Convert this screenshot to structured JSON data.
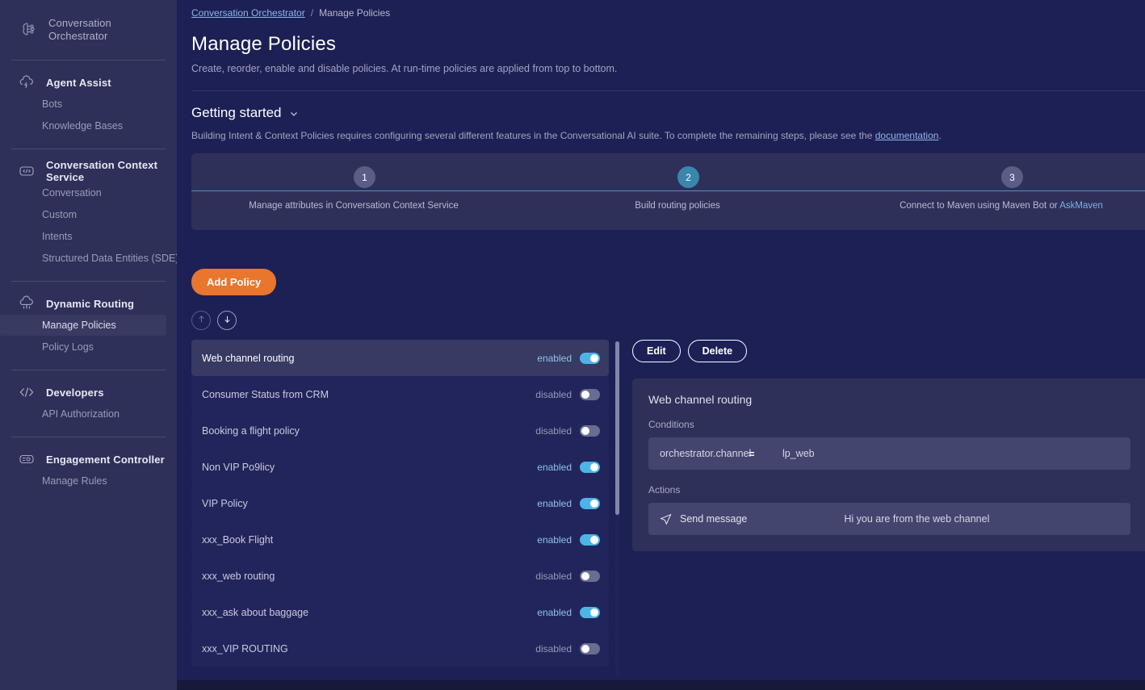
{
  "brand": {
    "line1": "Conversation",
    "line2": "Orchestrator",
    "icon": "brain-network-icon"
  },
  "sidebar": {
    "groups": [
      {
        "head": "Agent Assist",
        "icon": "cloud-lightning-icon",
        "items": [
          {
            "label": "Bots",
            "active": false
          },
          {
            "label": "Knowledge Bases",
            "active": false
          }
        ]
      },
      {
        "head": "Conversation Context Service",
        "icon": "code-bubble-icon",
        "items": [
          {
            "label": "Conversation",
            "active": false
          },
          {
            "label": "Custom",
            "active": false
          },
          {
            "label": "Intents",
            "active": false
          },
          {
            "label": "Structured Data Entities (SDE)",
            "active": false
          }
        ]
      },
      {
        "head": "Dynamic Routing",
        "icon": "cloud-routing-icon",
        "items": [
          {
            "label": "Manage Policies",
            "active": true
          },
          {
            "label": "Policy Logs",
            "active": false
          }
        ]
      },
      {
        "head": "Developers",
        "icon": "code-brackets-icon",
        "items": [
          {
            "label": "API Authorization",
            "active": false
          }
        ]
      },
      {
        "head": "Engagement Controller",
        "icon": "chat-gear-icon",
        "items": [
          {
            "label": "Manage Rules",
            "active": false
          }
        ]
      }
    ]
  },
  "breadcrumb": {
    "root": "Conversation Orchestrator",
    "separator": "/",
    "current": "Manage Policies"
  },
  "header": {
    "title": "Manage Policies",
    "subtitle": "Create, reorder, enable and disable policies. At run-time policies are applied from top to bottom."
  },
  "getting_started": {
    "title": "Getting started",
    "chevron_icon": "chevron-down-icon",
    "desc_before": "Building Intent & Context Policies requires configuring several different features in the Conversational AI suite. To complete the remaining steps, please see the ",
    "desc_link": "documentation",
    "desc_after": ".",
    "steps": [
      {
        "number": "1",
        "label": "Manage attributes in Conversation Context Service",
        "state": "muted",
        "link": ""
      },
      {
        "number": "2",
        "label": "Build routing policies",
        "state": "active",
        "link": ""
      },
      {
        "number": "3",
        "label": "Connect to Maven using Maven Bot or ",
        "state": "muted",
        "link": "AskMaven"
      }
    ]
  },
  "toolbar": {
    "add_policy_label": "Add Policy",
    "move_up_icon": "arrow-up-icon",
    "move_down_icon": "arrow-down-icon",
    "move_up_enabled": false,
    "move_down_enabled": true
  },
  "policy_list": {
    "state_on_label": "enabled",
    "state_off_label": "disabled",
    "rows": [
      {
        "name": "Web channel routing",
        "enabled": true,
        "selected": true
      },
      {
        "name": "Consumer Status from CRM",
        "enabled": false,
        "selected": false
      },
      {
        "name": "Booking a flight policy",
        "enabled": false,
        "selected": false
      },
      {
        "name": "Non VIP Po9licy",
        "enabled": true,
        "selected": false
      },
      {
        "name": "VIP Policy",
        "enabled": true,
        "selected": false
      },
      {
        "name": "xxx_Book Flight",
        "enabled": true,
        "selected": false
      },
      {
        "name": "xxx_web routing",
        "enabled": false,
        "selected": false
      },
      {
        "name": "xxx_ask about baggage",
        "enabled": true,
        "selected": false
      },
      {
        "name": "xxx_VIP ROUTING",
        "enabled": false,
        "selected": false
      }
    ]
  },
  "detail": {
    "edit_label": "Edit",
    "delete_label": "Delete",
    "title": "Web channel routing",
    "conditions_label": "Conditions",
    "conditions": [
      {
        "key": "orchestrator.channel",
        "operator": "=",
        "value": "lp_web"
      }
    ],
    "actions_label": "Actions",
    "actions": [
      {
        "icon": "send-message-icon",
        "name": "Send message",
        "value": "Hi you are from the web channel"
      }
    ]
  },
  "colors": {
    "sidebar_bg": "#2e3059",
    "main_bg": "#1d2055",
    "accent_orange": "#e8762c",
    "accent_blue": "#4cb4e7",
    "link_blue": "#8fb6e8",
    "step_active": "#3a86ad",
    "step_muted": "#5a5d85"
  }
}
